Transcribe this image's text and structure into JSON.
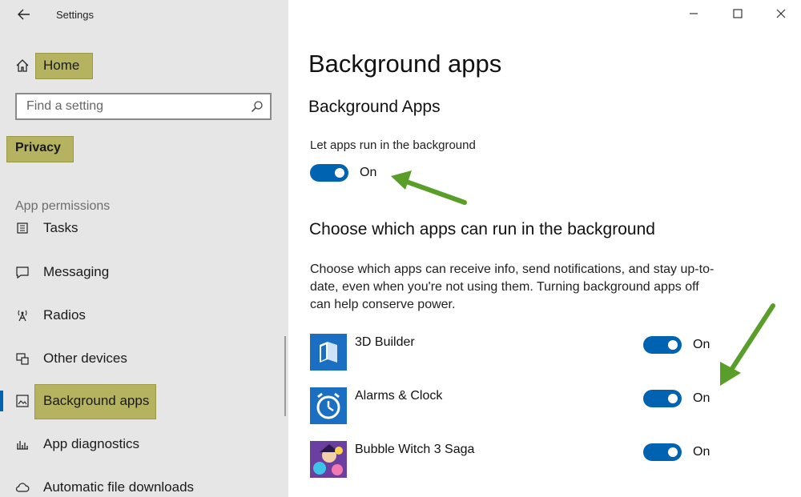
{
  "window": {
    "title": "Settings"
  },
  "sidebar": {
    "home_label": "Home",
    "search_placeholder": "Find a setting",
    "category_label": "Privacy",
    "section_label": "App permissions",
    "items": [
      {
        "label": "Tasks",
        "icon": "tasks-icon"
      },
      {
        "label": "Messaging",
        "icon": "messaging-icon"
      },
      {
        "label": "Radios",
        "icon": "radios-icon"
      },
      {
        "label": "Other devices",
        "icon": "other-devices-icon"
      },
      {
        "label": "Background apps",
        "icon": "background-apps-icon",
        "selected": true
      },
      {
        "label": "App diagnostics",
        "icon": "app-diagnostics-icon"
      },
      {
        "label": "Automatic file downloads",
        "icon": "cloud-icon"
      }
    ]
  },
  "main": {
    "page_title": "Background apps",
    "section1_title": "Background Apps",
    "setting_label": "Let apps run in the background",
    "setting_toggle_state": "On",
    "section2_title": "Choose which apps can run in the background",
    "description": "Choose which apps can receive info, send notifications, and stay up-to-date, even when you're not using them. Turning background apps off can help conserve power.",
    "apps": [
      {
        "name": "3D Builder",
        "state": "On",
        "icon": "3d-builder-icon"
      },
      {
        "name": "Alarms & Clock",
        "state": "On",
        "icon": "alarm-clock-icon"
      },
      {
        "name": "Bubble Witch 3 Saga",
        "state": "On",
        "icon": "bubble-witch-icon"
      }
    ]
  },
  "colors": {
    "accent": "#0063b1",
    "highlight": "#b5b35f",
    "annotation_arrow": "#5a9e2a",
    "sidebar_bg": "#e6e6e6"
  }
}
